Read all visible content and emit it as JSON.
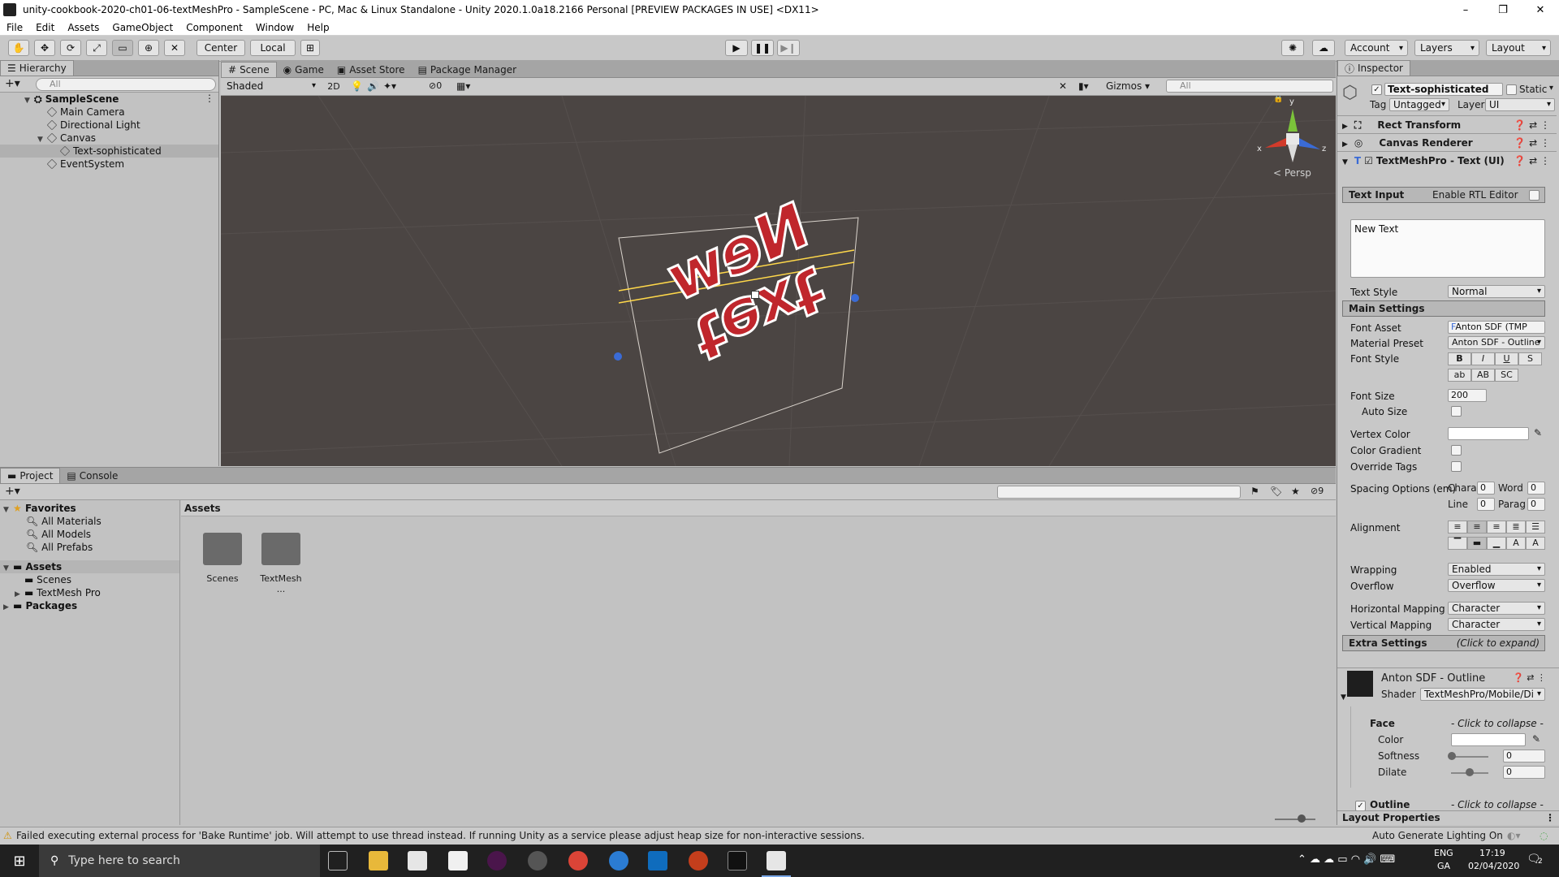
{
  "window": {
    "title": "unity-cookbook-2020-ch01-06-textMeshPro - SampleScene - PC, Mac & Linux Standalone - Unity 2020.1.0a18.2166 Personal [PREVIEW PACKAGES IN USE] <DX11>",
    "controls": [
      "–",
      "❐",
      "✕"
    ]
  },
  "menu": [
    "File",
    "Edit",
    "Assets",
    "GameObject",
    "Component",
    "Window",
    "Help"
  ],
  "toolbar": {
    "pivot_center": "Center",
    "pivot_local": "Local",
    "account": "Account",
    "layers": "Layers",
    "layout": "Layout"
  },
  "hierarchy": {
    "tab": "Hierarchy",
    "search_placeholder": "All",
    "items": [
      {
        "label": "SampleScene",
        "depth": 0
      },
      {
        "label": "Main Camera",
        "depth": 1
      },
      {
        "label": "Directional Light",
        "depth": 1
      },
      {
        "label": "Canvas",
        "depth": 1
      },
      {
        "label": "Text-sophisticated",
        "depth": 2
      },
      {
        "label": "EventSystem",
        "depth": 1
      }
    ]
  },
  "scene": {
    "tabs": [
      "Scene",
      "Game",
      "Asset Store",
      "Package Manager"
    ],
    "shading": "Shaded",
    "mode_2d": "2D",
    "hidden_count": "0",
    "gizmos": "Gizmos",
    "search_placeholder": "All",
    "persp": "< Persp",
    "axis_x": "x",
    "axis_y": "y",
    "axis_z": "z",
    "text_line1": "New",
    "text_line2": "text"
  },
  "inspector": {
    "tab": "Inspector",
    "object_name": "Text-sophisticated",
    "static_label": "Static",
    "tag_label": "Tag",
    "tag_value": "Untagged",
    "layer_label": "Layer",
    "layer_value": "UI",
    "components": [
      "Rect Transform",
      "Canvas Renderer",
      "TextMeshPro - Text (UI)"
    ],
    "text_input_header": "Text Input",
    "enable_rtl": "Enable RTL Editor",
    "text_value": "New Text",
    "text_style_label": "Text Style",
    "text_style_value": "Normal",
    "main_settings_header": "Main Settings",
    "font_asset_label": "Font Asset",
    "font_asset_value": "Anton SDF (TMP",
    "material_preset_label": "Material Preset",
    "material_preset_value": "Anton SDF - Outline",
    "font_style_label": "Font Style",
    "font_style_buttons": [
      "B",
      "I",
      "U",
      "S"
    ],
    "font_case_buttons": [
      "ab",
      "AB",
      "SC"
    ],
    "font_size_label": "Font Size",
    "font_size_value": "200",
    "auto_size_label": "Auto Size",
    "vertex_color_label": "Vertex Color",
    "color_gradient_label": "Color Gradient",
    "override_tags_label": "Override Tags",
    "spacing_label": "Spacing Options (em)",
    "spacing_char_label": "Chara",
    "spacing_char_value": "0",
    "spacing_word_label": "Word",
    "spacing_word_value": "0",
    "spacing_line_label": "Line",
    "spacing_line_value": "0",
    "spacing_para_label": "Parag",
    "spacing_para_value": "0",
    "alignment_label": "Alignment",
    "wrapping_label": "Wrapping",
    "wrapping_value": "Enabled",
    "overflow_label": "Overflow",
    "overflow_value": "Overflow",
    "hmap_label": "Horizontal Mapping",
    "hmap_value": "Character",
    "vmap_label": "Vertical Mapping",
    "vmap_value": "Character",
    "extra_settings_header": "Extra Settings",
    "extra_settings_hint": "(Click to expand)",
    "material_name": "Anton SDF - Outline",
    "shader_label": "Shader",
    "shader_value": "TextMeshPro/Mobile/Di",
    "face_label": "Face",
    "collapse_hint": "- Click to collapse -",
    "face_color_label": "Color",
    "softness_label": "Softness",
    "softness_value": "0",
    "dilate_label": "Dilate",
    "dilate_value": "0",
    "outline_label": "Outline",
    "layout_props": "Layout Properties"
  },
  "project": {
    "tabs": [
      "Project",
      "Console"
    ],
    "hidden_count": "9",
    "favorites_label": "Favorites",
    "favorites": [
      "All Materials",
      "All Models",
      "All Prefabs"
    ],
    "assets_label": "Assets",
    "asset_children": [
      "Scenes",
      "TextMesh Pro"
    ],
    "packages_label": "Packages",
    "breadcrumb": "Assets",
    "folders": [
      "Scenes",
      "TextMesh ..."
    ]
  },
  "status": {
    "message": "Failed executing external process for 'Bake Runtime' job. Will attempt to use thread instead. If running Unity as a service please adjust heap size for non-interactive sessions.",
    "lighting": "Auto Generate Lighting On"
  },
  "taskbar": {
    "search_placeholder": "Type here to search",
    "lang1": "ENG",
    "lang2": "GA",
    "time": "17:19",
    "date": "02/04/2020",
    "notification_count": "2"
  },
  "colors": {
    "scene_bg": "#4b4543",
    "selection_yellow": "#ffd84a",
    "text_red": "#c0262c",
    "axis_red": "#d23b2b",
    "axis_green": "#7bc33a",
    "axis_blue": "#3a6bd6"
  }
}
